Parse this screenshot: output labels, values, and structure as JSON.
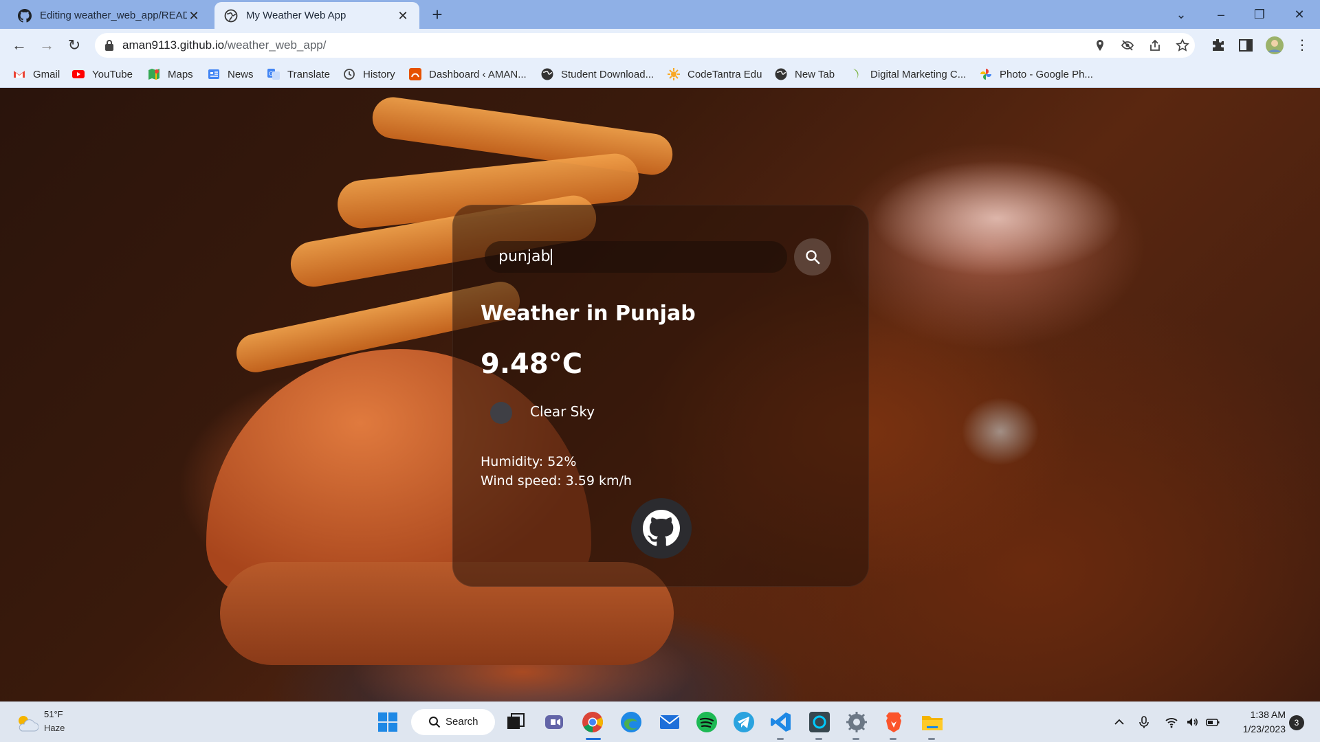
{
  "browser": {
    "tabs": [
      {
        "title": "Editing weather_web_app/READ",
        "icon": "github-icon",
        "active": false
      },
      {
        "title": "My Weather Web App",
        "icon": "globe-icon",
        "active": true
      }
    ],
    "url_host": "aman9113.github.io",
    "url_path": "/weather_web_app/",
    "bookmarks": [
      {
        "label": "Gmail",
        "icon": "gmail-icon",
        "color": "#ea4335"
      },
      {
        "label": "YouTube",
        "icon": "youtube-icon",
        "color": "#ff0000"
      },
      {
        "label": "Maps",
        "icon": "maps-icon",
        "color": "#34a853"
      },
      {
        "label": "News",
        "icon": "news-icon",
        "color": "#4285f4"
      },
      {
        "label": "Translate",
        "icon": "translate-icon",
        "color": "#4285f4"
      },
      {
        "label": "History",
        "icon": "history-icon",
        "color": "#444444"
      },
      {
        "label": "Dashboard ‹ AMAN...",
        "icon": "dashboard-icon",
        "color": "#e65100"
      },
      {
        "label": "Student Download...",
        "icon": "globe-icon",
        "color": "#333333"
      },
      {
        "label": "CodeTantra Edu",
        "icon": "codetantra-icon",
        "color": "#f9a825"
      },
      {
        "label": "New Tab",
        "icon": "globe-icon",
        "color": "#333333"
      },
      {
        "label": "Digital Marketing C...",
        "icon": "digital-marketing-icon",
        "color": "#7cb342"
      },
      {
        "label": "Photo - Google Ph...",
        "icon": "google-photos-icon",
        "color": "#fbbc05"
      }
    ]
  },
  "weather": {
    "search_value": "punjab",
    "city_heading": "Weather in Punjab",
    "temperature": "9.48°C",
    "condition": "Clear Sky",
    "humidity": "Humidity: 52%",
    "wind": "Wind speed: 3.59 km/h"
  },
  "taskbar": {
    "weather_temp": "51°F",
    "weather_cond": "Haze",
    "search_label": "Search",
    "time": "1:38 AM",
    "date": "1/23/2023",
    "notifications": "3"
  }
}
